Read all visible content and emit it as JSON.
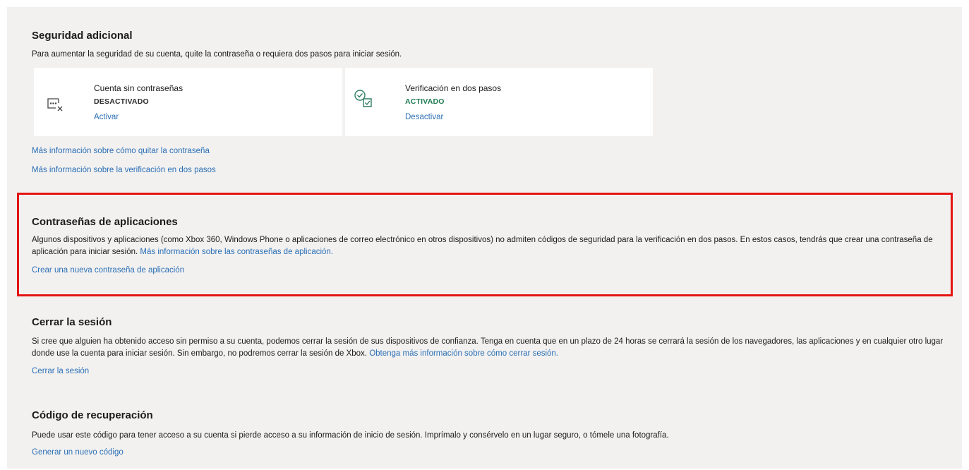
{
  "security": {
    "title": "Seguridad adicional",
    "description": "Para aumentar la seguridad de su cuenta, quite la contraseña o requiera dos pasos para iniciar sesión.",
    "cards": [
      {
        "title": "Cuenta sin contraseñas",
        "status": "DESACTIVADO",
        "action": "Activar",
        "icon": "password-off-icon"
      },
      {
        "title": "Verificación en dos pasos",
        "status": "ACTIVADO",
        "action": "Desactivar",
        "icon": "two-step-check-icon"
      }
    ],
    "links": [
      "Más información sobre cómo quitar la contraseña",
      "Más información sobre la verificación en dos pasos"
    ]
  },
  "app_passwords": {
    "title": "Contraseñas de aplicaciones",
    "description": "Algunos dispositivos y aplicaciones (como Xbox 360, Windows Phone o aplicaciones de correo electrónico en otros dispositivos) no admiten códigos de seguridad para la verificación en dos pasos. En estos casos, tendrás que crear una contraseña de aplicación para iniciar sesión.",
    "info_link": "Más información sobre las contraseñas de aplicación.",
    "action": "Crear una nueva contraseña de aplicación"
  },
  "sign_out": {
    "title": "Cerrar la sesión",
    "description": "Si cree que alguien ha obtenido acceso sin permiso a su cuenta, podemos cerrar la sesión de sus dispositivos de confianza. Tenga en cuenta que en un plazo de 24 horas se cerrará la sesión de los navegadores, las aplicaciones y en cualquier otro lugar donde use la cuenta para iniciar sesión. Sin embargo, no podremos cerrar la sesión de Xbox.",
    "info_link": "Obtenga más información sobre cómo cerrar sesión.",
    "action": "Cerrar la sesión"
  },
  "recovery": {
    "title": "Código de recuperación",
    "description": "Puede usar este código para tener acceso a su cuenta si pierde acceso a su información de inicio de sesión. Imprímalo y consérvelo en un lugar seguro, o tómele una fotografía.",
    "action": "Generar un nuevo código"
  },
  "colors": {
    "link": "#2b6fb5",
    "active_status": "#1e7a52",
    "highlight_border": "#e51313",
    "panel_background": "#f2f1f0"
  }
}
